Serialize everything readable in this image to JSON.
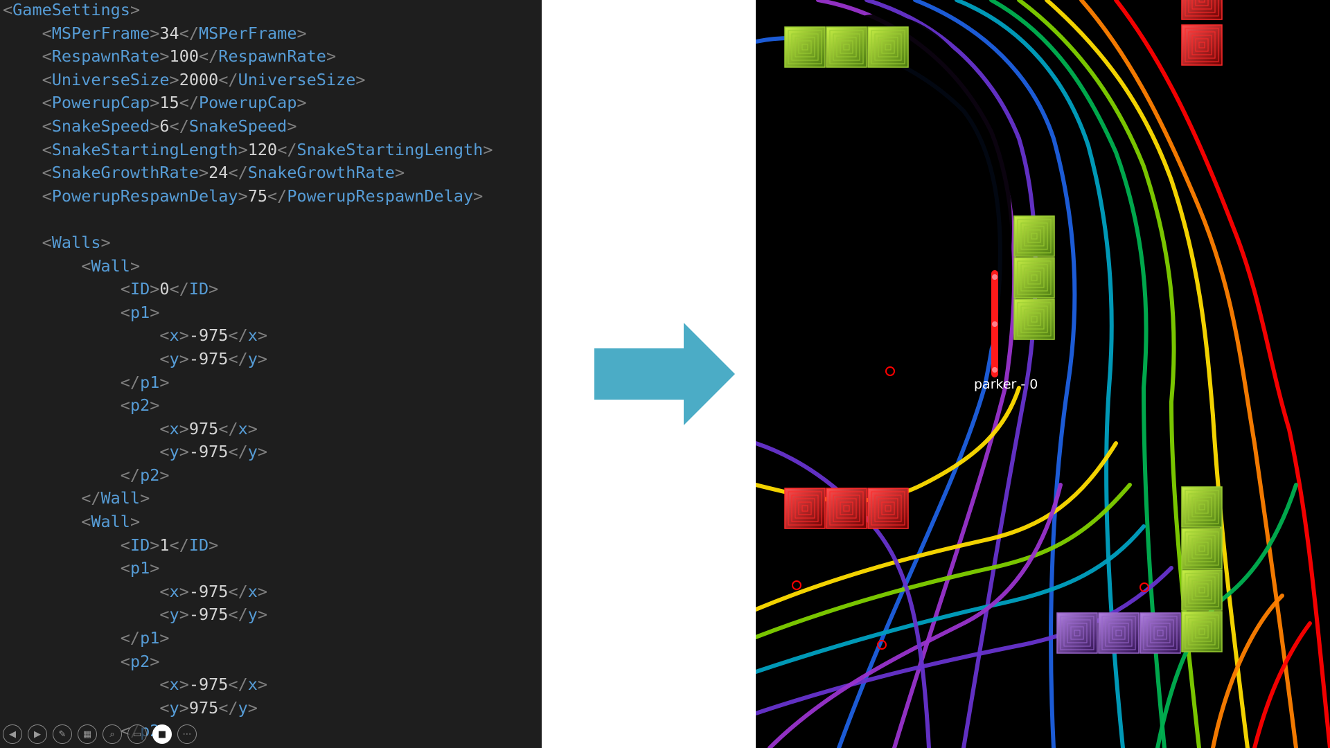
{
  "code_lines": [
    {
      "indent": "",
      "kind": "open",
      "tag": "GameSettings"
    },
    {
      "indent": "    ",
      "kind": "elem",
      "tag": "MSPerFrame",
      "value": "34"
    },
    {
      "indent": "    ",
      "kind": "elem",
      "tag": "RespawnRate",
      "value": "100"
    },
    {
      "indent": "    ",
      "kind": "elem",
      "tag": "UniverseSize",
      "value": "2000"
    },
    {
      "indent": "    ",
      "kind": "elem",
      "tag": "PowerupCap",
      "value": "15"
    },
    {
      "indent": "    ",
      "kind": "elem",
      "tag": "SnakeSpeed",
      "value": "6"
    },
    {
      "indent": "    ",
      "kind": "elem",
      "tag": "SnakeStartingLength",
      "value": "120"
    },
    {
      "indent": "    ",
      "kind": "elem",
      "tag": "SnakeGrowthRate",
      "value": "24"
    },
    {
      "indent": "    ",
      "kind": "elem",
      "tag": "PowerupRespawnDelay",
      "value": "75"
    },
    {
      "indent": "",
      "kind": "blank"
    },
    {
      "indent": "    ",
      "kind": "open",
      "tag": "Walls"
    },
    {
      "indent": "        ",
      "kind": "open",
      "tag": "Wall"
    },
    {
      "indent": "            ",
      "kind": "elem",
      "tag": "ID",
      "value": "0"
    },
    {
      "indent": "            ",
      "kind": "open",
      "tag": "p1"
    },
    {
      "indent": "                ",
      "kind": "elem",
      "tag": "x",
      "value": "-975"
    },
    {
      "indent": "                ",
      "kind": "elem",
      "tag": "y",
      "value": "-975"
    },
    {
      "indent": "            ",
      "kind": "close",
      "tag": "p1"
    },
    {
      "indent": "            ",
      "kind": "open",
      "tag": "p2"
    },
    {
      "indent": "                ",
      "kind": "elem",
      "tag": "x",
      "value": "975"
    },
    {
      "indent": "                ",
      "kind": "elem",
      "tag": "y",
      "value": "-975"
    },
    {
      "indent": "            ",
      "kind": "close",
      "tag": "p2"
    },
    {
      "indent": "        ",
      "kind": "close",
      "tag": "Wall"
    },
    {
      "indent": "        ",
      "kind": "open",
      "tag": "Wall"
    },
    {
      "indent": "            ",
      "kind": "elem",
      "tag": "ID",
      "value": "1"
    },
    {
      "indent": "            ",
      "kind": "open",
      "tag": "p1"
    },
    {
      "indent": "                ",
      "kind": "elem",
      "tag": "x",
      "value": "-975"
    },
    {
      "indent": "                ",
      "kind": "elem",
      "tag": "y",
      "value": "-975"
    },
    {
      "indent": "            ",
      "kind": "close",
      "tag": "p1"
    },
    {
      "indent": "            ",
      "kind": "open",
      "tag": "p2"
    },
    {
      "indent": "                ",
      "kind": "elem",
      "tag": "x",
      "value": "-975"
    },
    {
      "indent": "                ",
      "kind": "elem",
      "tag": "y",
      "value": "975"
    },
    {
      "indent": "            ",
      "kind": "close",
      "tag": "p2"
    }
  ],
  "toolbar": {
    "buttons": [
      {
        "name": "previous-slide-button",
        "icon": "arrow-left-icon",
        "glyph": "◀"
      },
      {
        "name": "next-slide-button",
        "icon": "arrow-right-icon",
        "glyph": "▶"
      },
      {
        "name": "pen-button",
        "icon": "pen-icon",
        "glyph": "✎"
      },
      {
        "name": "all-slides-button",
        "icon": "grid-icon",
        "glyph": "▦"
      },
      {
        "name": "zoom-button",
        "icon": "magnifier-icon",
        "glyph": "⌕"
      },
      {
        "name": "subtitles-button",
        "icon": "subtitles-icon",
        "glyph": "▭"
      },
      {
        "name": "camera-button",
        "icon": "video-camera-icon",
        "glyph": "■",
        "active": true
      },
      {
        "name": "more-options-button",
        "icon": "ellipsis-icon",
        "glyph": "⋯"
      }
    ]
  },
  "arrow": {
    "color": "#4bacc6",
    "icon": "right-arrow-icon"
  },
  "game": {
    "background": "#000000",
    "player_label": "parker - 0",
    "snake_color": "#ff1a1a",
    "wall_colors": {
      "green": "#9acd32",
      "red": "#ff2a2a",
      "purple": "#9966cc"
    },
    "powerup_color": "#ff0000",
    "trail_colors": [
      "#ff0000",
      "#ff7f00",
      "#ffdd00",
      "#7fd000",
      "#00b050",
      "#00a0c0",
      "#1e60e0",
      "#6633cc",
      "#9933cc"
    ]
  }
}
